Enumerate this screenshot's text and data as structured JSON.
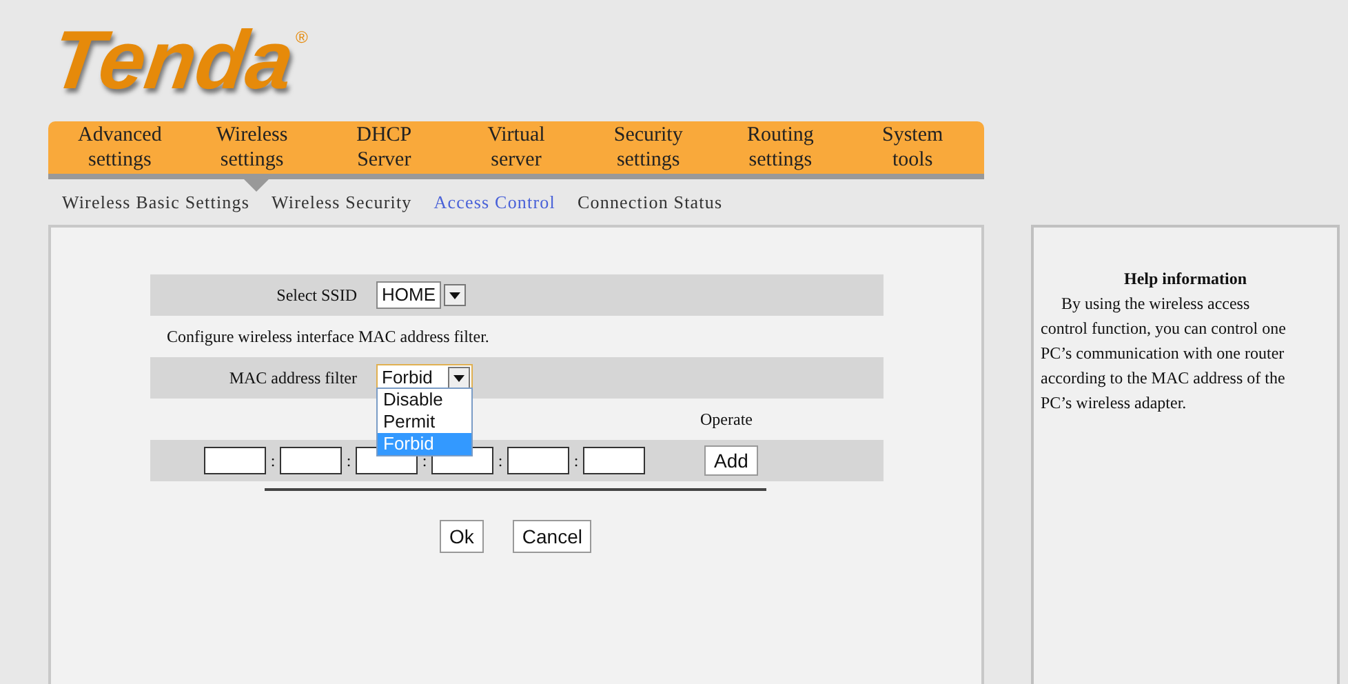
{
  "logo": {
    "name": "Tenda",
    "mark": "®"
  },
  "nav": [
    {
      "label": [
        "Advanced",
        "settings"
      ],
      "selected": false
    },
    {
      "label": [
        "Wireless",
        "settings"
      ],
      "selected": true
    },
    {
      "label": [
        "DHCP",
        "Server"
      ],
      "selected": false
    },
    {
      "label": [
        "Virtual",
        "server"
      ],
      "selected": false
    },
    {
      "label": [
        "Security",
        "settings"
      ],
      "selected": false
    },
    {
      "label": [
        "Routing",
        "settings"
      ],
      "selected": false
    },
    {
      "label": [
        "System",
        "tools"
      ],
      "selected": false
    }
  ],
  "subtabs": [
    {
      "label": "Wireless Basic Settings",
      "selected": false
    },
    {
      "label": "Wireless Security",
      "selected": false
    },
    {
      "label": "Access Control",
      "selected": true
    },
    {
      "label": "Connection Status",
      "selected": false
    }
  ],
  "form": {
    "ssid": {
      "label": "Select SSID",
      "value": "HOME"
    },
    "description": "Configure wireless interface MAC address filter.",
    "filter": {
      "label": "MAC address filter",
      "value": "Forbid",
      "expanded": true,
      "options": [
        {
          "label": "Disable",
          "selected": false
        },
        {
          "label": "Permit",
          "selected": false
        },
        {
          "label": "Forbid",
          "selected": true
        }
      ]
    },
    "operate_header": "Operate",
    "mac_separators": [
      ":",
      ":",
      ":",
      ":",
      ":"
    ],
    "add_button": "Add",
    "buttons": [
      "Ok",
      "Cancel"
    ]
  },
  "help": {
    "title": "Help information",
    "text": "By using the wireless access control function, you can control one PC’s communication with one router according to the MAC address of the PC’s wireless adapter."
  }
}
